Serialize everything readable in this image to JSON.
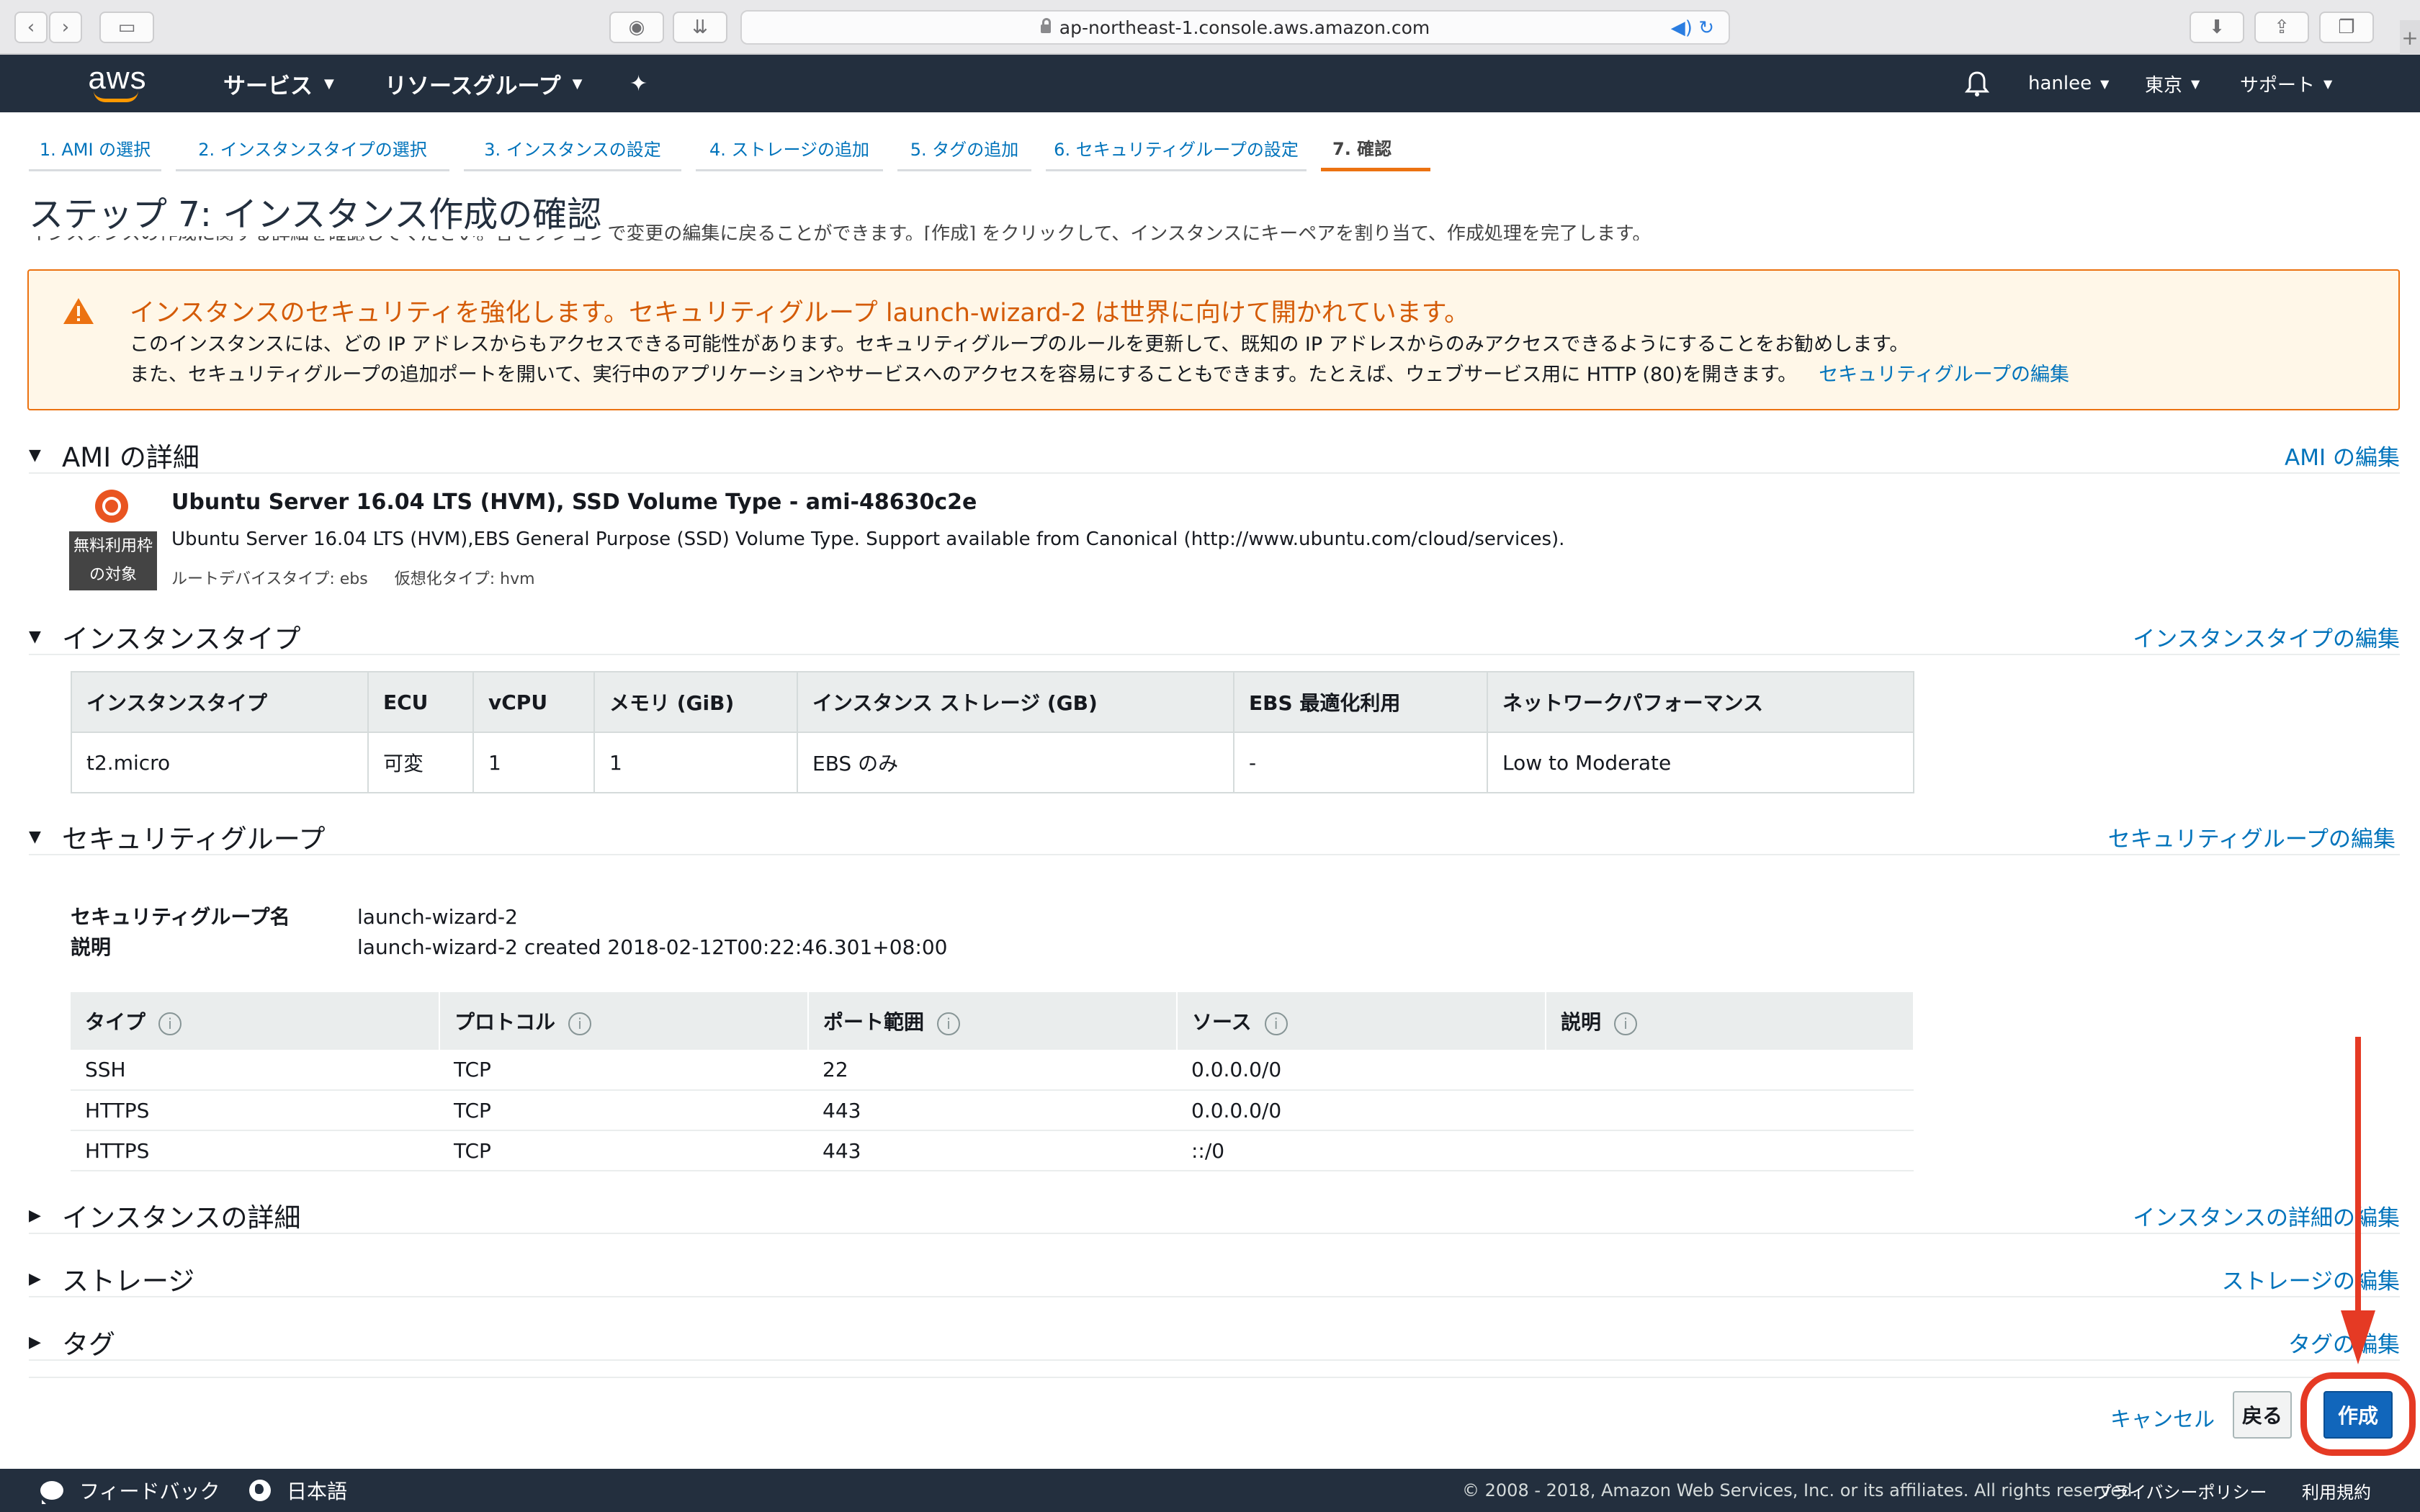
{
  "browser": {
    "url": "ap-northeast-1.console.aws.amazon.com"
  },
  "nav": {
    "logo": "aws",
    "services": "サービス",
    "resource_groups": "リソースグループ",
    "user": "hanlee",
    "region": "東京",
    "support": "サポート"
  },
  "wizard": {
    "tabs": [
      "1. AMI の選択",
      "2. インスタンスタイプの選択",
      "3. インスタンスの設定",
      "4. ストレージの追加",
      "5. タグの追加",
      "6. セキュリティグループの設定",
      "7. 確認"
    ],
    "active_index": 6
  },
  "page": {
    "title": "ステップ 7: インスタンス作成の確認",
    "description": "インスタンスの作成に関する詳細を確認してください。各セクションで変更の編集に戻ることができます。[作成] をクリックして、インスタンスにキーペアを割り当て、作成処理を完了します。"
  },
  "warning": {
    "title": "インスタンスのセキュリティを強化します。セキュリティグループ launch-wizard-2 は世界に向けて開かれています。",
    "line1": "このインスタンスには、どの IP アドレスからもアクセスできる可能性があります。セキュリティグループのルールを更新して、既知の IP アドレスからのみアクセスできるようにすることをお勧めします。",
    "line2": "また、セキュリティグループの追加ポートを開いて、実行中のアプリケーションやサービスへのアクセスを容易にすることもできます。たとえば、ウェブサービス用に HTTP (80)を開きます。",
    "link": "セキュリティグループの編集"
  },
  "sections": {
    "ami": {
      "title": "AMI の詳細",
      "edit": "AMI の編集"
    },
    "instance_type": {
      "title": "インスタンスタイプ",
      "edit": "インスタンスタイプの編集"
    },
    "security_group": {
      "title": "セキュリティグループ",
      "edit": "セキュリティグループの編集"
    },
    "instance_details": {
      "title": "インスタンスの詳細",
      "edit": "インスタンスの詳細の編集"
    },
    "storage": {
      "title": "ストレージ",
      "edit": "ストレージの編集"
    },
    "tags": {
      "title": "タグ",
      "edit": "タグの編集"
    }
  },
  "ami": {
    "free_tier_line1": "無料利用枠",
    "free_tier_line2": "の対象",
    "name": "Ubuntu Server 16.04 LTS (HVM), SSD Volume Type - ami-48630c2e",
    "description": "Ubuntu Server 16.04 LTS (HVM),EBS General Purpose (SSD) Volume Type. Support available from Canonical (http://www.ubuntu.com/cloud/services).",
    "root_device": "ルートデバイスタイプ: ebs",
    "virtualization": "仮想化タイプ: hvm"
  },
  "instance_table": {
    "headers": [
      "インスタンスタイプ",
      "ECU",
      "vCPU",
      "メモリ (GiB)",
      "インスタンス ストレージ (GB)",
      "EBS 最適化利用",
      "ネットワークパフォーマンス"
    ],
    "row": [
      "t2.micro",
      "可変",
      "1",
      "1",
      "EBS のみ",
      "-",
      "Low to Moderate"
    ]
  },
  "security_group": {
    "name_label": "セキュリティグループ名",
    "name_value": "launch-wizard-2",
    "desc_label": "説明",
    "desc_value": "launch-wizard-2 created 2018-02-12T00:22:46.301+08:00",
    "headers": [
      "タイプ",
      "プロトコル",
      "ポート範囲",
      "ソース",
      "説明"
    ],
    "rules": [
      [
        "SSH",
        "TCP",
        "22",
        "0.0.0.0/0",
        ""
      ],
      [
        "HTTPS",
        "TCP",
        "443",
        "0.0.0.0/0",
        ""
      ],
      [
        "HTTPS",
        "TCP",
        "443",
        "::/0",
        ""
      ]
    ]
  },
  "actions": {
    "cancel": "キャンセル",
    "back": "戻る",
    "launch": "作成"
  },
  "footer": {
    "feedback": "フィードバック",
    "language": "日本語",
    "copyright": "© 2008 - 2018, Amazon Web Services, Inc. or its affiliates. All rights reserved.",
    "privacy": "プライバシーポリシー",
    "terms": "利用規約"
  },
  "colors": {
    "nav_bg": "#232f3e",
    "link": "#0073bb",
    "warning_border": "#ec7211",
    "primary_button": "#1166bb",
    "annotation_red": "#e53a24"
  }
}
